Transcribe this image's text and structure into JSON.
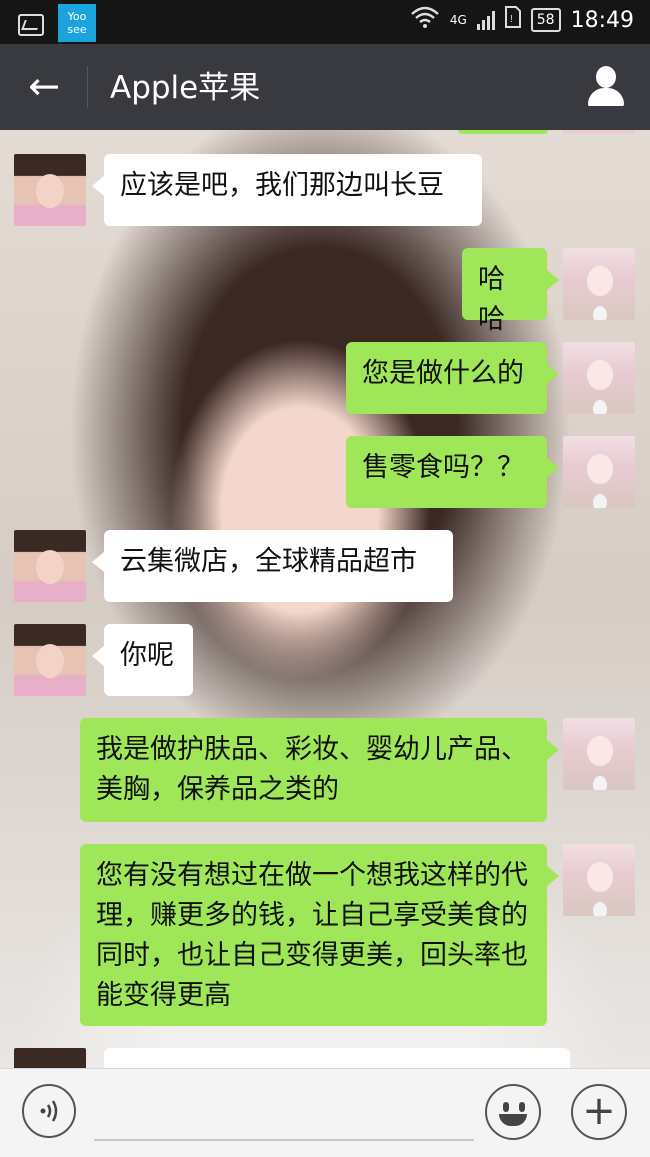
{
  "status_bar": {
    "time": "18:49",
    "network": "4G",
    "battery": "58",
    "yoosee_label": "Yoo see"
  },
  "header": {
    "back_icon": "←",
    "title": "Apple苹果",
    "profile_icon": "person-icon"
  },
  "messages": [
    {
      "from": "other",
      "text": "应该是吧，我们那边叫长豆"
    },
    {
      "from": "self",
      "text": "哈哈"
    },
    {
      "from": "self",
      "text": "您是做什么的"
    },
    {
      "from": "self",
      "text": "售零食吗？？"
    },
    {
      "from": "other",
      "text": "云集微店，全球精品超市"
    },
    {
      "from": "other",
      "text": "你呢"
    },
    {
      "from": "self",
      "text": "我是做护肤品、彩妆、婴幼儿产品、美胸，保养品之类的"
    },
    {
      "from": "self",
      "text": "您有没有想过在做一个想我这样的代理，赚更多的钱，让自己享受美食的同时，也让自己变得更美，回头率也能变得更高"
    }
  ],
  "input_bar": {
    "voice_icon": "voice-icon",
    "emoji_icon": "emoji-icon",
    "plus_icon": "+"
  },
  "colors": {
    "header_bg": "#393a3f",
    "self_bubble": "#9fe658",
    "other_bubble": "#ffffff",
    "statusbar_bg": "#151515"
  }
}
